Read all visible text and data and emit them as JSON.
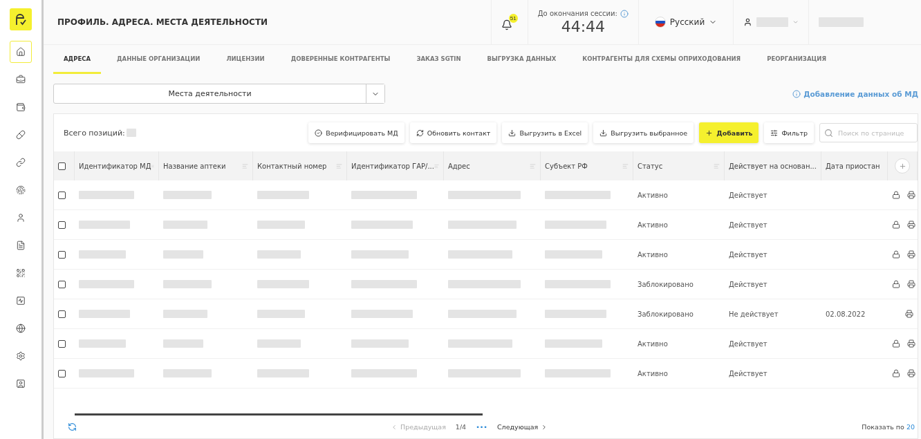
{
  "header": {
    "title": "ПРОФИЛЬ. АДРЕСА. МЕСТА ДЕЯТЕЛЬНОСТИ",
    "notifications_badge": "51",
    "session": {
      "label": "До окончания сессии:",
      "time": "44:44"
    },
    "language": "Русский"
  },
  "sidebar": {
    "items": [
      {
        "kind": "home",
        "selected": true
      },
      {
        "kind": "briefcase",
        "selected": false
      },
      {
        "kind": "wallet",
        "selected": false
      },
      {
        "kind": "pill",
        "selected": false
      },
      {
        "kind": "link",
        "selected": false
      },
      {
        "kind": "fingerprint",
        "selected": false
      },
      {
        "kind": "user",
        "selected": false
      },
      {
        "kind": "document",
        "selected": false
      },
      {
        "kind": "qr",
        "selected": false
      },
      {
        "kind": "chart",
        "selected": false
      },
      {
        "kind": "globe",
        "selected": false
      },
      {
        "kind": "settings",
        "selected": false
      },
      {
        "kind": "info",
        "selected": false
      }
    ]
  },
  "tabs": [
    {
      "label": "АДРЕСА",
      "selected": true
    },
    {
      "label": "ДАННЫЕ ОРГАНИЗАЦИИ",
      "selected": false
    },
    {
      "label": "ЛИЦЕНЗИИ",
      "selected": false
    },
    {
      "label": "ДОВЕРЕННЫЕ КОНТРАГЕНТЫ",
      "selected": false
    },
    {
      "label": "ЗАКАЗ SGTIN",
      "selected": false
    },
    {
      "label": "ВЫГРУЗКА ДАННЫХ",
      "selected": false
    },
    {
      "label": "КОНТРАГЕНТЫ ДЛЯ СХЕМЫ ОПРИХОДОВАНИЯ",
      "selected": false
    },
    {
      "label": "РЕОРГАНИЗАЦИЯ",
      "selected": false
    }
  ],
  "place_select": {
    "value": "Места деятельности"
  },
  "info_link": "Добавление данных об МД",
  "toolbar": {
    "total_label": "Всего позиций:",
    "buttons": [
      {
        "kind": "verify",
        "label": "Верифицировать МД"
      },
      {
        "kind": "refresh",
        "label": "Обновить контакт"
      },
      {
        "kind": "download",
        "label": "Выгрузить в Excel"
      },
      {
        "kind": "download",
        "label": "Выгрузить выбранное"
      },
      {
        "kind": "add",
        "label": "Добавить"
      },
      {
        "kind": "filter",
        "label": "Фильтр"
      }
    ],
    "search": {
      "placeholder": "Поиск по странице"
    }
  },
  "table": {
    "all_checked": false,
    "columns": [
      "Идентификатор МД",
      "Название аптеки",
      "Контактный номер",
      "Идентификатор ГАР/...",
      "Адрес",
      "Субъект РФ",
      "Статус",
      "Действует на основан...",
      "Дата приостан"
    ],
    "rows": [
      {
        "checked": false,
        "status": "Активно",
        "basis": "Действует",
        "locked": true
      },
      {
        "checked": false,
        "status": "Активно",
        "basis": "Действует",
        "locked": true
      },
      {
        "checked": false,
        "status": "Активно",
        "basis": "Действует",
        "locked": true
      },
      {
        "checked": false,
        "status": "Заблокировано",
        "basis": "Действует",
        "locked": true
      },
      {
        "checked": false,
        "status": "Заблокировано",
        "basis": "Не действует",
        "date": "02.08.2022",
        "locked": false
      },
      {
        "checked": false,
        "status": "Активно",
        "basis": "Действует",
        "locked": true
      },
      {
        "checked": false,
        "status": "Активно",
        "basis": "Действует",
        "locked": true
      }
    ]
  },
  "pagination": {
    "prev": "Предыдущая",
    "page": "1/4",
    "more": "•••",
    "next": "Следующая",
    "page_size_label": "Показать по",
    "page_size": "20"
  }
}
